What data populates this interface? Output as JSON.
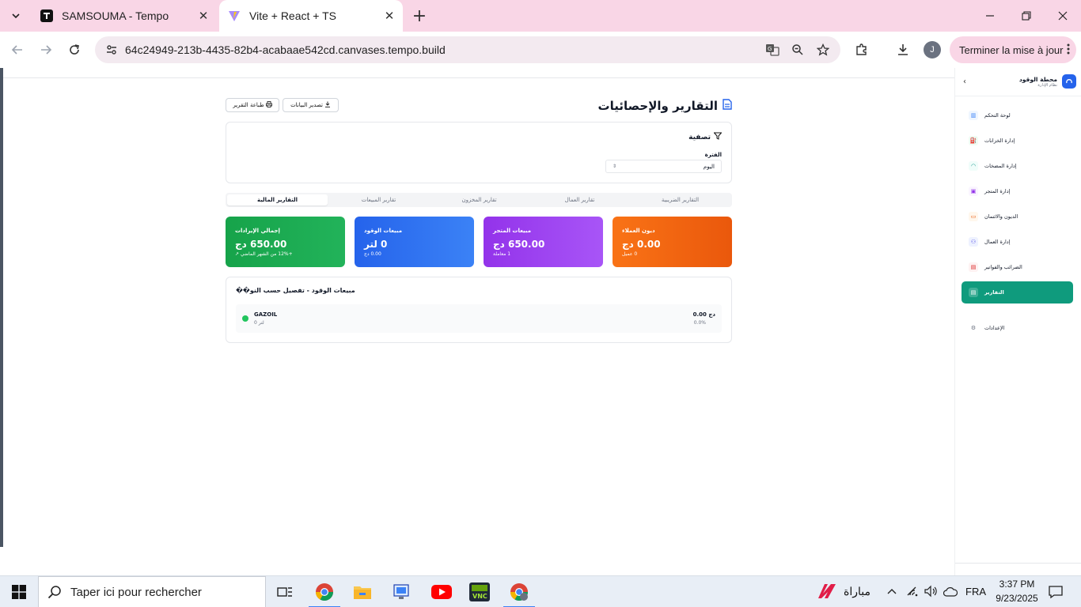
{
  "browser": {
    "tabs": [
      {
        "title": "SAMSOUMA - Tempo",
        "active": false
      },
      {
        "title": "Vite + React + TS",
        "active": true
      }
    ],
    "url": "64c24949-213b-4435-82b4-acabaae542cd.canvases.tempo.build",
    "profile_initial": "J",
    "update_button": "Terminer la mise à jour"
  },
  "page": {
    "title": "التقارير والإحصائيات",
    "export_button": "تصدير البيانات",
    "print_button": "طباعة التقرير",
    "filter": {
      "heading": "تصفية",
      "period_label": "الفترة",
      "period_value": "اليوم"
    },
    "report_tabs": [
      {
        "label": "التقارير الضريبية",
        "active": false
      },
      {
        "label": "تقارير العمال",
        "active": false
      },
      {
        "label": "تقارير المخزون",
        "active": false
      },
      {
        "label": "تقارير المبيعات",
        "active": false
      },
      {
        "label": "التقارير المالية",
        "active": true
      }
    ],
    "stats": [
      {
        "label": "إجمالي الإيرادات",
        "value": "650.00 دج",
        "sub": "+12% من الشهر الماضي ↗",
        "color": "#16a34a"
      },
      {
        "label": "مبيعات الوقود",
        "value": "0 لتر",
        "sub": "0.00 دج",
        "color": "#2563eb"
      },
      {
        "label": "مبيعات المتجر",
        "value": "650.00 دج",
        "sub": "1 معاملة",
        "color": "#9333ea"
      },
      {
        "label": "ديون العملاء",
        "value": "0.00 دج",
        "sub": "0 عميل",
        "color": "#ea580c"
      }
    ],
    "fuel_detail": {
      "title": "مبيعات الوقود - تفصيل حسب النو��",
      "rows": [
        {
          "name": "GAZOIL",
          "quantity": "0 لتر",
          "amount": "0.00 دج",
          "percent": "0.0%"
        }
      ]
    }
  },
  "sidebar": {
    "brand": "محطة الوقود",
    "subtitle": "نظام الإدارة",
    "items": [
      {
        "label": "لوحة التحكم",
        "icon": "chart-bar-icon",
        "active": false
      },
      {
        "label": "إدارة الخزانات",
        "icon": "fuel-tank-icon",
        "active": false
      },
      {
        "label": "إدارة المضخات",
        "icon": "gauge-icon",
        "active": false
      },
      {
        "label": "إدارة المتجر",
        "icon": "shopping-bag-icon",
        "active": false
      },
      {
        "label": "الديون والائتمان",
        "icon": "credit-card-icon",
        "active": false
      },
      {
        "label": "إدارة العمال",
        "icon": "users-icon",
        "active": false
      },
      {
        "label": "الضرائب والفواتير",
        "icon": "receipt-icon",
        "active": false
      },
      {
        "label": "التقارير",
        "icon": "document-icon",
        "active": true
      },
      {
        "label": "الإعدادات",
        "icon": "gear-icon",
        "active": false
      }
    ]
  },
  "taskbar": {
    "search_placeholder": "Taper ici pour rechercher",
    "weather_text": "مباراة",
    "language": "FRA",
    "time": "3:37 PM",
    "date": "9/23/2025"
  }
}
